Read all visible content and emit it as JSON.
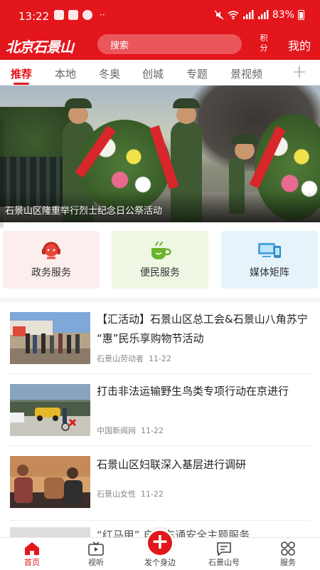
{
  "status_bar": {
    "time": "13:22",
    "dots": "··",
    "battery": "83%"
  },
  "header": {
    "logo": "北京石景山",
    "search_placeholder": "搜索",
    "points": "积分",
    "mine": "我的"
  },
  "tabs": [
    {
      "label": "推荐",
      "active": true
    },
    {
      "label": "本地"
    },
    {
      "label": "冬奥"
    },
    {
      "label": "创城"
    },
    {
      "label": "专题"
    },
    {
      "label": "景视频"
    }
  ],
  "tab_more": "+",
  "banner": {
    "caption": "石景山区隆重举行烈士纪念日公祭活动"
  },
  "services": [
    {
      "label": "政务服务",
      "icon": "headset-icon"
    },
    {
      "label": "便民服务",
      "icon": "cup-icon"
    },
    {
      "label": "媒体矩阵",
      "icon": "devices-icon"
    }
  ],
  "news": [
    {
      "title": "【汇活动】石景山区总工会&石景山八角苏宁 “惠”民乐享购物节活动",
      "source": "石景山劳动者",
      "date": "11-22"
    },
    {
      "title": "打击非法运输野生鸟类专项行动在京进行",
      "source": "中国新闻网",
      "date": "11-22"
    },
    {
      "title": "石景山区妇联深入基层进行调研",
      "source": "石景山女性",
      "date": "11-22"
    },
    {
      "title": "“红马甲” 自行车通安全主题服务"
    }
  ],
  "bottom_nav": [
    {
      "label": "首页",
      "active": true,
      "icon": "home-icon"
    },
    {
      "label": "视听",
      "icon": "tv-icon"
    },
    {
      "label": "发个身边",
      "icon": "plus-icon"
    },
    {
      "label": "石景山号",
      "icon": "message-icon"
    },
    {
      "label": "服务",
      "icon": "grid-icon"
    }
  ],
  "fab": "+",
  "colors": {
    "brand": "#e3161c"
  }
}
